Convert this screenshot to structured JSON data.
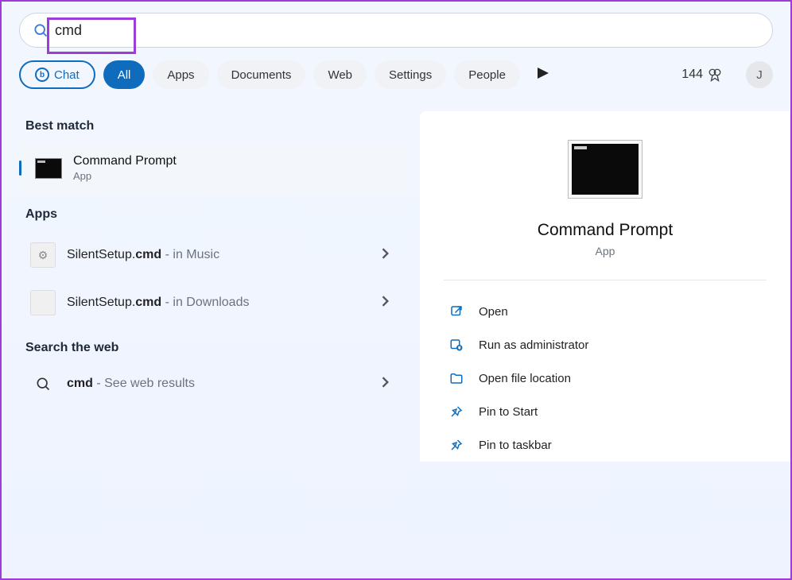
{
  "search": {
    "value": "cmd"
  },
  "filters": {
    "chat": "Chat",
    "items": [
      "All",
      "Apps",
      "Documents",
      "Web",
      "Settings",
      "People"
    ],
    "active_index": 0
  },
  "rewards": {
    "points": "144",
    "avatar_initial": "J"
  },
  "sections": {
    "best_match": "Best match",
    "apps": "Apps",
    "search_web": "Search the web"
  },
  "best_match": {
    "title": "Command Prompt",
    "subtitle": "App"
  },
  "app_results": [
    {
      "prefix": "SilentSetup.",
      "match": "cmd",
      "location": " - in Music"
    },
    {
      "prefix": "SilentSetup.",
      "match": "cmd",
      "location": " - in Downloads"
    }
  ],
  "web_result": {
    "match": "cmd",
    "suffix": " - See web results"
  },
  "preview": {
    "title": "Command Prompt",
    "subtitle": "App"
  },
  "actions": [
    {
      "icon": "open",
      "label": "Open"
    },
    {
      "icon": "admin",
      "label": "Run as administrator"
    },
    {
      "icon": "folder",
      "label": "Open file location"
    },
    {
      "icon": "pinstart",
      "label": "Pin to Start"
    },
    {
      "icon": "pintaskbar",
      "label": "Pin to taskbar"
    }
  ]
}
